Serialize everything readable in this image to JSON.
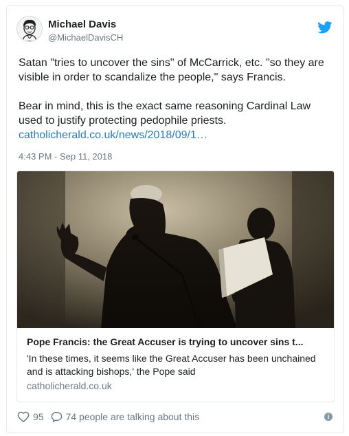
{
  "author": {
    "name": "Michael Davis",
    "handle": "@MichaelDavisCH"
  },
  "tweet": {
    "paragraph1": "Satan \"tries to uncover the sins\" of McCarrick, etc. \"so they are visible in order to scandalize the people,\" says Francis.",
    "paragraph2": "Bear in mind, this is the exact same reasoning Cardinal Law used to justify protecting pedophile priests.",
    "link": "catholicherald.co.uk/news/2018/09/1…",
    "timestamp": "4:43 PM - Sep 11, 2018"
  },
  "media_card": {
    "title": "Pope Francis: the Great Accuser is trying to uncover sins t...",
    "description": "'In these times, it seems like the Great Accuser has been unchained and is attacking bishops,' the Pope said",
    "domain": "catholicherald.co.uk"
  },
  "engagement": {
    "likes": "95",
    "talking": "74 people are talking about this"
  },
  "icons": {
    "brand": "twitter-bird-icon",
    "like": "heart-icon",
    "reply": "speech-bubble-icon",
    "info": "info-icon"
  },
  "colors": {
    "link": "#2b7bb9",
    "brand": "#1da1f2",
    "muted": "#697882"
  }
}
